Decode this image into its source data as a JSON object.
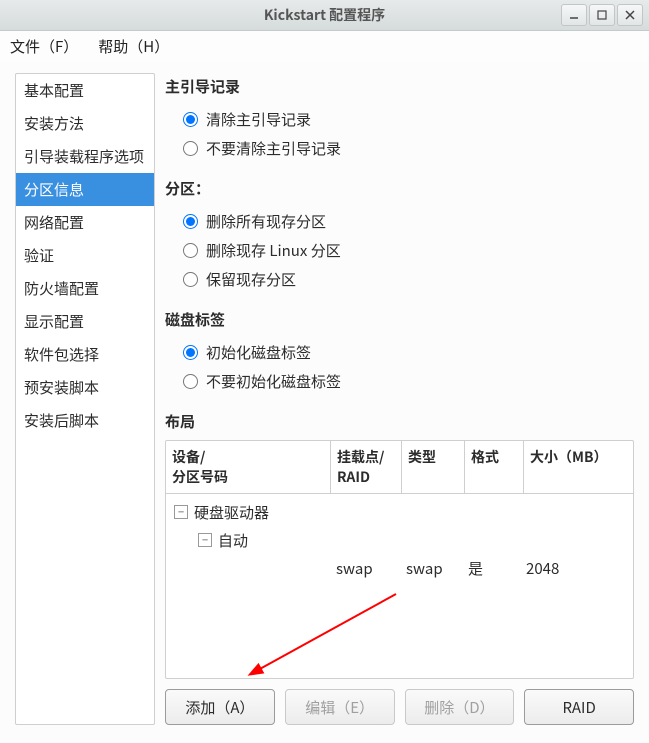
{
  "window": {
    "title": "Kickstart 配置程序"
  },
  "menubar": {
    "file": "文件（F）",
    "help": "帮助（H）"
  },
  "sidebar": {
    "items": [
      {
        "label": "基本配置"
      },
      {
        "label": "安装方法"
      },
      {
        "label": "引导装载程序选项"
      },
      {
        "label": "分区信息"
      },
      {
        "label": "网络配置"
      },
      {
        "label": "验证"
      },
      {
        "label": "防火墙配置"
      },
      {
        "label": "显示配置"
      },
      {
        "label": "软件包选择"
      },
      {
        "label": "预安装脚本"
      },
      {
        "label": "安装后脚本"
      }
    ],
    "selected_index": 3
  },
  "sections": {
    "mbr": {
      "title": "主引导记录",
      "opts": [
        "清除主引导记录",
        "不要清除主引导记录"
      ],
      "selected": 0
    },
    "partitions": {
      "title": "分区：",
      "opts": [
        "删除所有现存分区",
        "删除现存 Linux 分区",
        "保留现存分区"
      ],
      "selected": 0
    },
    "disklabel": {
      "title": "磁盘标签",
      "opts": [
        "初始化磁盘标签",
        "不要初始化磁盘标签"
      ],
      "selected": 0
    }
  },
  "layout": {
    "title": "布局",
    "columns": {
      "device": "设备/\n分区号码",
      "mount": "挂载点/\nRAID",
      "type": "类型",
      "format": "格式",
      "size": "大小（MB）"
    },
    "tree": {
      "root": "硬盘驱动器",
      "child": "自动",
      "row": {
        "mount": "swap",
        "type": "swap",
        "format": "是",
        "size": "2048"
      }
    }
  },
  "buttons": {
    "add": "添加（A）",
    "edit": "编辑（E）",
    "delete": "删除（D）",
    "raid": "RAID"
  }
}
